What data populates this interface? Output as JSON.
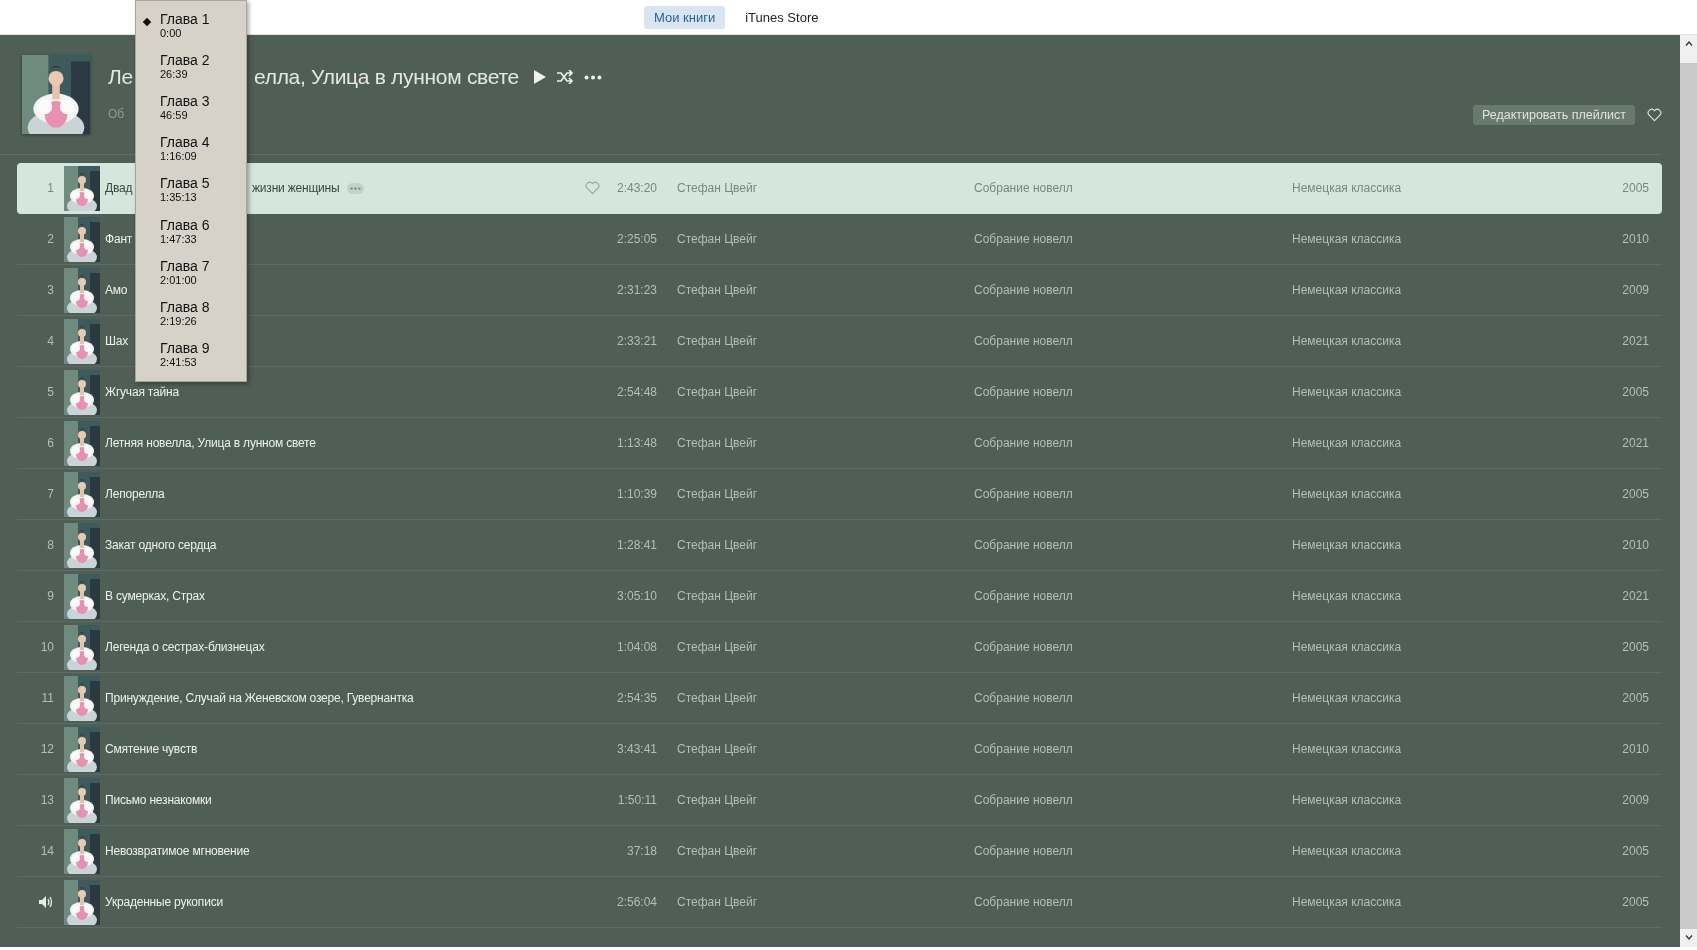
{
  "top_tabs": [
    {
      "label": "Мои книги",
      "selected": true
    },
    {
      "label": "iTunes Store",
      "selected": false
    }
  ],
  "playlist": {
    "title_start": "Ле",
    "title_end": "елла, Улица в лунном свете",
    "subtitle": "Об",
    "edit_button": "Редактировать плейлист"
  },
  "tracks": [
    {
      "number": "1",
      "title_start": "Двад",
      "title_end": "жизни женщины",
      "duration": "2:43:20",
      "artist": "Стефан Цвейг",
      "album": "Собрание новелл",
      "genre": "Немецкая классика",
      "year": "2005",
      "selected": true,
      "playing": false
    },
    {
      "number": "2",
      "title_start": "Фант",
      "duration": "2:25:05",
      "artist": "Стефан Цвейг",
      "album": "Собрание новелл",
      "genre": "Немецкая классика",
      "year": "2010",
      "selected": false,
      "playing": false
    },
    {
      "number": "3",
      "title_start": "Амо",
      "duration": "2:31:23",
      "artist": "Стефан Цвейг",
      "album": "Собрание новелл",
      "genre": "Немецкая классика",
      "year": "2009",
      "selected": false,
      "playing": false
    },
    {
      "number": "4",
      "title_start": "Шах",
      "duration": "2:33:21",
      "artist": "Стефан Цвейг",
      "album": "Собрание новелл",
      "genre": "Немецкая классика",
      "year": "2021",
      "selected": false,
      "playing": false
    },
    {
      "number": "5",
      "title_start": "Жгучая тайна",
      "duration": "2:54:48",
      "artist": "Стефан Цвейг",
      "album": "Собрание новелл",
      "genre": "Немецкая классика",
      "year": "2005",
      "selected": false,
      "playing": false
    },
    {
      "number": "6",
      "title_start": "Летняя новелла, Улица в лунном свете",
      "duration": "1:13:48",
      "artist": "Стефан Цвейг",
      "album": "Собрание новелл",
      "genre": "Немецкая классика",
      "year": "2021",
      "selected": false,
      "playing": false
    },
    {
      "number": "7",
      "title_start": "Лепорелла",
      "duration": "1:10:39",
      "artist": "Стефан Цвейг",
      "album": "Собрание новелл",
      "genre": "Немецкая классика",
      "year": "2005",
      "selected": false,
      "playing": false
    },
    {
      "number": "8",
      "title_start": "Закат одного сердца",
      "duration": "1:28:41",
      "artist": "Стефан Цвейг",
      "album": "Собрание новелл",
      "genre": "Немецкая классика",
      "year": "2010",
      "selected": false,
      "playing": false
    },
    {
      "number": "9",
      "title_start": "В сумерках, Страх",
      "duration": "3:05:10",
      "artist": "Стефан Цвейг",
      "album": "Собрание новелл",
      "genre": "Немецкая классика",
      "year": "2021",
      "selected": false,
      "playing": false
    },
    {
      "number": "10",
      "title_start": "Легенда о сестрах-близнецах",
      "duration": "1:04:08",
      "artist": "Стефан Цвейг",
      "album": "Собрание новелл",
      "genre": "Немецкая классика",
      "year": "2005",
      "selected": false,
      "playing": false
    },
    {
      "number": "11",
      "title_start": "Принуждение, Случай на Женевском озере, Гувернантка",
      "duration": "2:54:35",
      "artist": "Стефан Цвейг",
      "album": "Собрание новелл",
      "genre": "Немецкая классика",
      "year": "2005",
      "selected": false,
      "playing": false
    },
    {
      "number": "12",
      "title_start": "Смятение чувств",
      "duration": "3:43:41",
      "artist": "Стефан Цвейг",
      "album": "Собрание новелл",
      "genre": "Немецкая классика",
      "year": "2010",
      "selected": false,
      "playing": false
    },
    {
      "number": "13",
      "title_start": "Письмо незнакомки",
      "duration": "1:50:11",
      "artist": "Стефан Цвейг",
      "album": "Собрание новелл",
      "genre": "Немецкая классика",
      "year": "2009",
      "selected": false,
      "playing": false
    },
    {
      "number": "14",
      "title_start": "Невозвратимое мгновение",
      "duration": "37:18",
      "artist": "Стефан Цвейг",
      "album": "Собрание новелл",
      "genre": "Немецкая классика",
      "year": "2005",
      "selected": false,
      "playing": false
    },
    {
      "title_start": "Украденные рукописи",
      "duration": "2:56:04",
      "artist": "Стефан Цвейг",
      "album": "Собрание новелл",
      "genre": "Немецкая классика",
      "year": "2005",
      "selected": false,
      "playing": true
    }
  ],
  "chapter_menu": [
    {
      "label": "Глава 1",
      "time": "0:00",
      "selected": true
    },
    {
      "label": "Глава 2",
      "time": "26:39",
      "selected": false
    },
    {
      "label": "Глава 3",
      "time": "46:59",
      "selected": false
    },
    {
      "label": "Глава 4",
      "time": "1:16:09",
      "selected": false
    },
    {
      "label": "Глава 5",
      "time": "1:35:13",
      "selected": false
    },
    {
      "label": "Глава 6",
      "time": "1:47:33",
      "selected": false
    },
    {
      "label": "Глава 7",
      "time": "2:01:00",
      "selected": false
    },
    {
      "label": "Глава 8",
      "time": "2:19:26",
      "selected": false
    },
    {
      "label": "Глава 9",
      "time": "2:41:53",
      "selected": false
    }
  ]
}
